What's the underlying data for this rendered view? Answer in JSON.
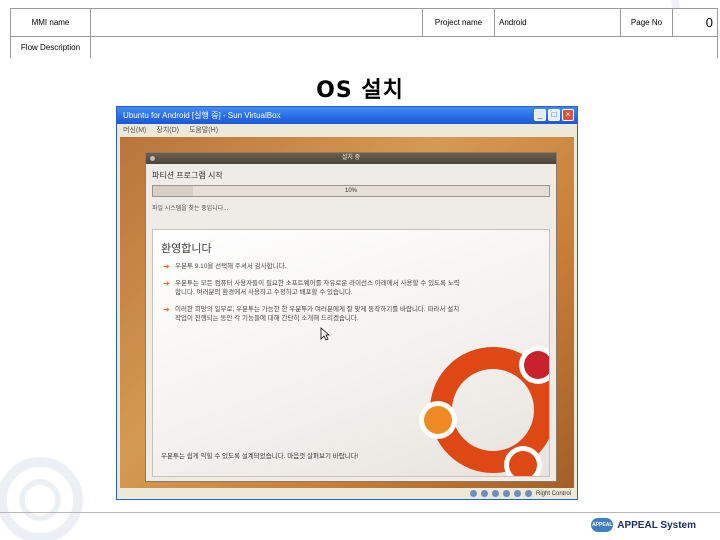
{
  "header": {
    "mmi_name_label": "MMI name",
    "mmi_name_value": "",
    "project_name_label": "Project name",
    "project_name_value": "Android",
    "page_no_label": "Page No",
    "page_no_value": "0",
    "flow_description_label": "Flow Description",
    "flow_description_value": ""
  },
  "page_title": "OS 설치",
  "vbox": {
    "title": "Ubuntu for Android [실행 중] - Sun VirtualBox",
    "menu": [
      "머신(M)",
      "장치(D)",
      "도움말(H)"
    ],
    "window_buttons": {
      "minimize": "_",
      "maximize": "□",
      "close": "×"
    },
    "status_text": "Right Control"
  },
  "installer": {
    "title": "설치 중",
    "heading": "파티션 프로그램 시작",
    "progress_percent": 10,
    "progress_label": "10%",
    "status": "파일 시스템을 찾는 중입니다...",
    "welcome": "환영합니다",
    "bullets": [
      "우분투 9.10을 선택해 주셔서 감사합니다.",
      "우분투는 모든 컴퓨터 사용자들이 필요한 소프트웨어를 자유로운 라이선스 아래에서 사용할 수 있도록 노력합니다. 여러분의 환경에서 사용하고 수정하고 배포할 수 있습니다.",
      "이러한 희망의 일부로, 우분투는 가능한 한 우분투가 여러분에게 잘 맞게 동작하기를 바랍니다. 따라서 설치 작업이 진행되는 동안 각 기능들에 대해 간단히 소개해 드리겠습니다."
    ],
    "closing": "우분투는 쉽게 익힐 수 있도록 설계되었습니다. 마음껏 살펴보기 바랍니다!"
  },
  "footer": {
    "brand_badge": "APPEAL",
    "brand": "APPEAL System"
  },
  "colors": {
    "ubuntu_orange": "#dd4814",
    "ubuntu_red": "#c8222c",
    "xp_blue": "#1b56d8",
    "brand_navy": "#1f2f63"
  }
}
